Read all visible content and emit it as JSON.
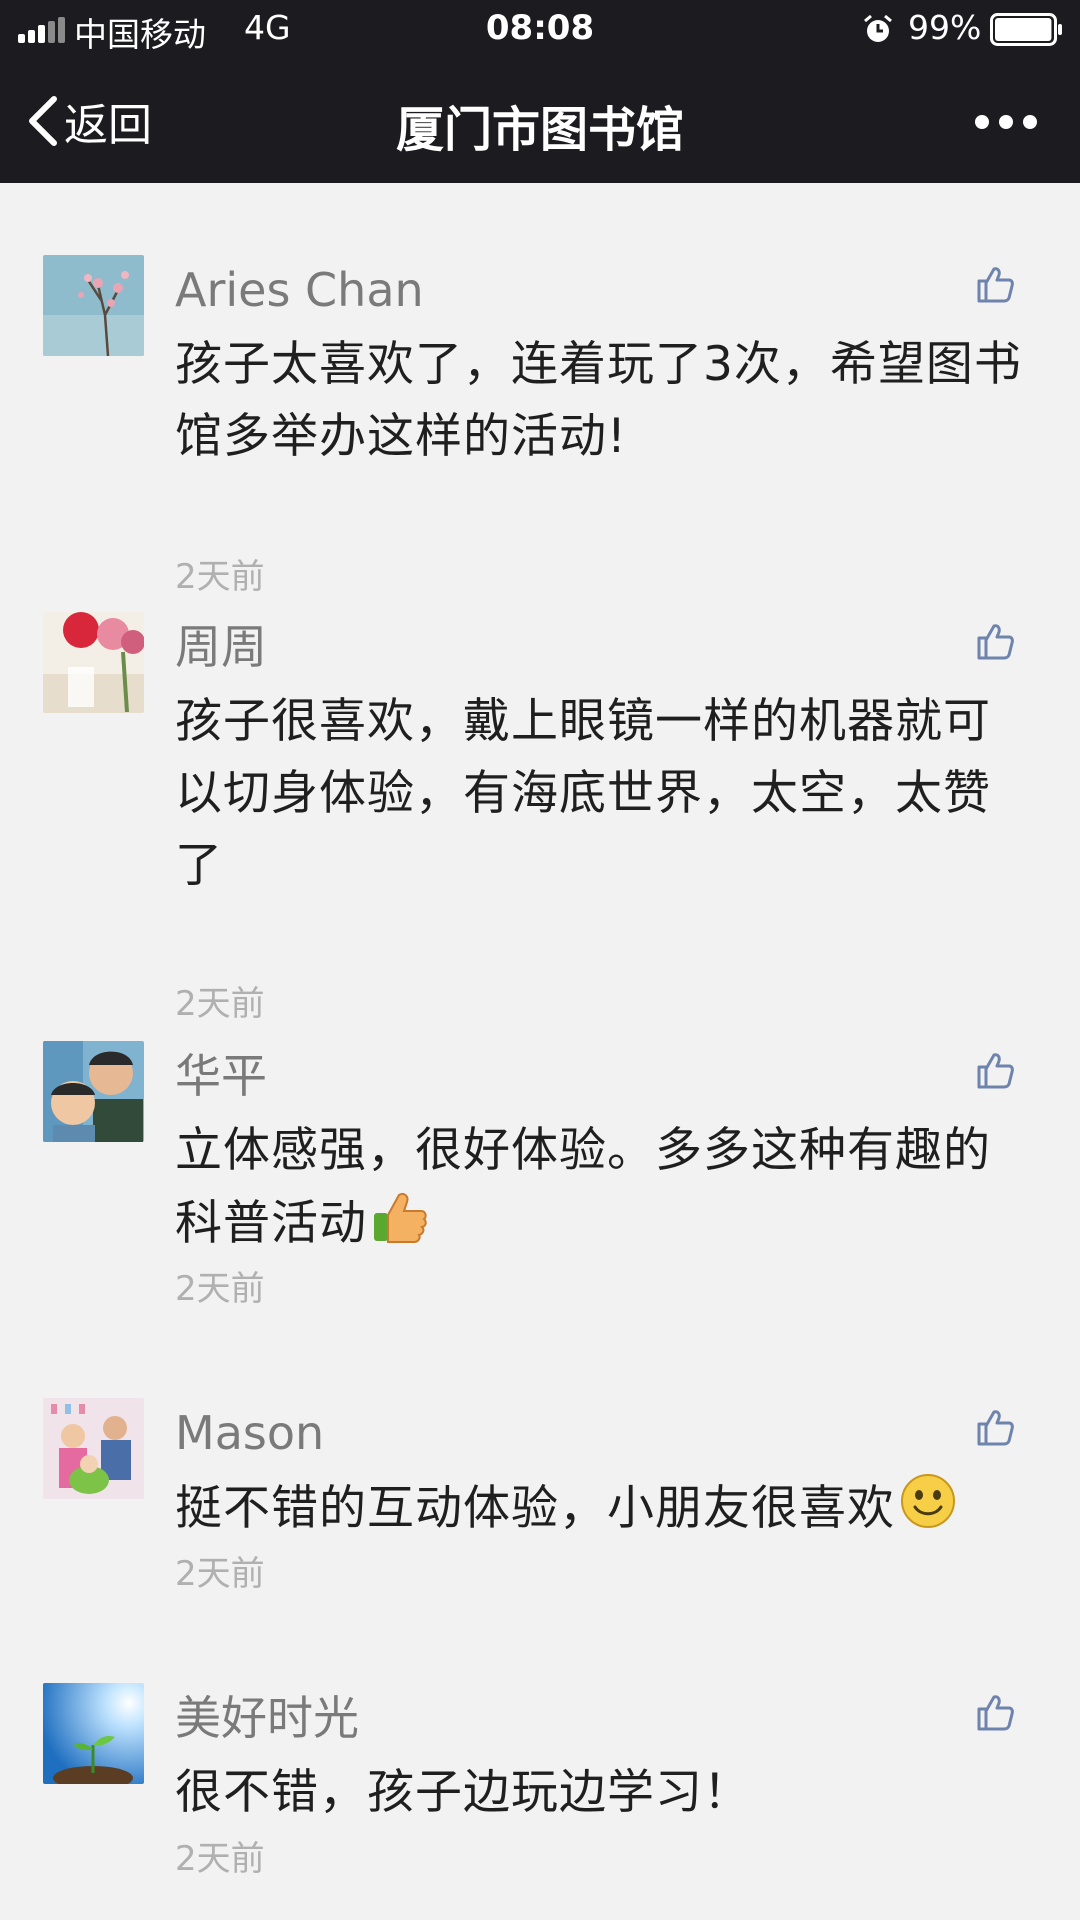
{
  "status_bar": {
    "carrier": "中国移动",
    "network": "4G",
    "time": "08:08",
    "battery": "99%",
    "battery_level": 0.99
  },
  "nav": {
    "back_label": "返回",
    "title": "厦门市图书馆"
  },
  "comments": [
    {
      "name": "Aries Chan",
      "text": "孩子太喜欢了，连着玩了3次，希望图书馆多举办这样的活动!",
      "time": "2天前",
      "emoji": ""
    },
    {
      "name": "周周",
      "text": "孩子很喜欢，戴上眼镜一样的机器就可以切身体验，有海底世界，太空，太赞了",
      "time": "2天前",
      "emoji": ""
    },
    {
      "name": "华平",
      "text": "立体感强，很好体验。多多这种有趣的科普活动",
      "time": "2天前",
      "emoji": "thumbs-up-emoji"
    },
    {
      "name": "Mason",
      "text": "挺不错的互动体验，小朋友很喜欢",
      "time": "2天前",
      "emoji": "smiley-emoji"
    },
    {
      "name": "美好时光",
      "text": "很不错，孩子边玩边学习！",
      "time": "2天前",
      "emoji": ""
    }
  ],
  "colors": {
    "header_bg": "#1c1c20",
    "page_bg": "#f2f2f2",
    "name": "#7a7a7a",
    "body_text": "#1f1f1f",
    "timestamp": "#b0b0b0",
    "like_icon": "#6f84ad"
  },
  "icons": [
    "back-chevron-icon",
    "more-dots-icon",
    "like-icon",
    "alarm-icon",
    "battery-icon",
    "signal-icon"
  ]
}
